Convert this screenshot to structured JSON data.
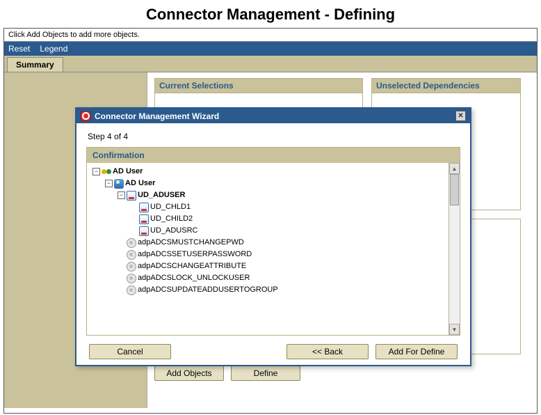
{
  "page_title": "Connector Management - Defining",
  "hint_text": "Click Add Objects to add more objects.",
  "menubar": {
    "reset": "Reset",
    "legend": "Legend"
  },
  "tabs": {
    "summary": "Summary"
  },
  "panels": {
    "current_selections": "Current Selections",
    "unselected_dependencies": "Unselected Dependencies"
  },
  "buttons": {
    "add_objects": "Add Objects",
    "define": "Define"
  },
  "modal": {
    "title": "Connector Management Wizard",
    "step": "Step 4 of 4",
    "section": "Confirmation",
    "buttons": {
      "cancel": "Cancel",
      "back": "<< Back",
      "add_for_define": "Add For Define"
    },
    "tree": {
      "root": {
        "label": "AD User",
        "expanded": true,
        "icon": "group",
        "bold": true,
        "children": [
          {
            "label": "AD User",
            "expanded": true,
            "icon": "user",
            "bold": true,
            "children": [
              {
                "label": "UD_ADUSER",
                "expanded": true,
                "icon": "form",
                "bold": true,
                "children": [
                  {
                    "label": "UD_CHLD1",
                    "icon": "form"
                  },
                  {
                    "label": "UD_CHILD2",
                    "icon": "form"
                  },
                  {
                    "label": "UD_ADUSRC",
                    "icon": "form"
                  }
                ]
              },
              {
                "label": "adpADCSMUSTCHANGEPWD",
                "icon": "adapter"
              },
              {
                "label": "adpADCSSETUSERPASSWORD",
                "icon": "adapter"
              },
              {
                "label": "adpADCSCHANGEATTRIBUTE",
                "icon": "adapter"
              },
              {
                "label": "adpADCSLOCK_UNLOCKUSER",
                "icon": "adapter"
              },
              {
                "label": "adpADCSUPDATEADDUSERTOGROUP",
                "icon": "adapter"
              }
            ]
          }
        ]
      }
    }
  }
}
